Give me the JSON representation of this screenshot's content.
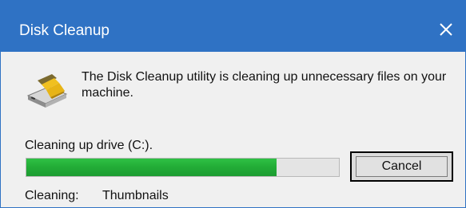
{
  "window": {
    "title": "Disk Cleanup",
    "close_icon": "close-icon"
  },
  "main": {
    "icon": "disk-cleanup-icon",
    "message": "The Disk Cleanup utility is cleaning up unnecessary files on your machine.",
    "status": "Cleaning up drive  (C:).",
    "progress_percent": 80,
    "cancel_label": "Cancel",
    "cleaning_label": "Cleaning:",
    "cleaning_item": "Thumbnails"
  },
  "colors": {
    "titlebar": "#2f72c4",
    "progress_fill": "#23ad37",
    "progress_track": "#e4e4e4",
    "background": "#f0f0f0"
  }
}
